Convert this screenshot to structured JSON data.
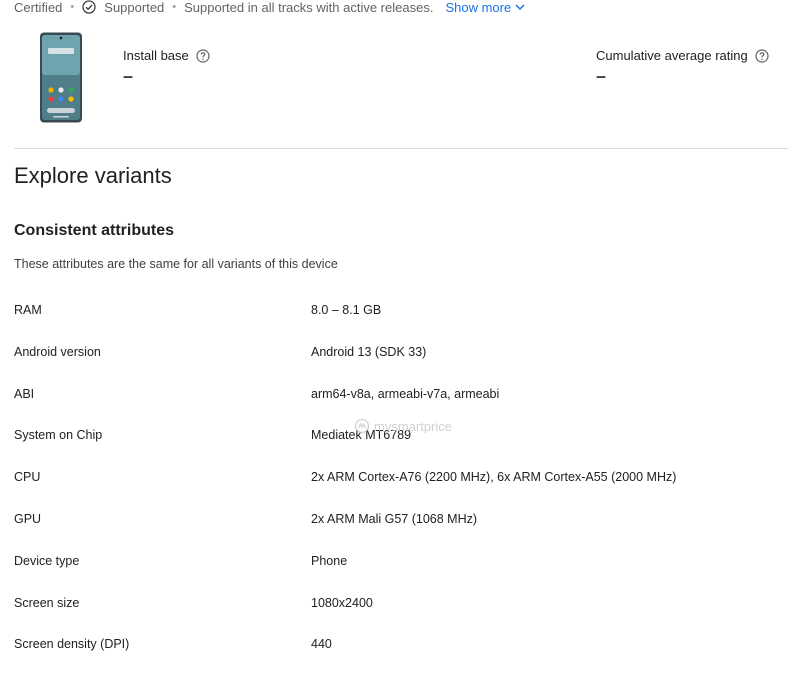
{
  "topbar": {
    "certified": "Certified",
    "supported": "Supported",
    "tracks": "Supported in all tracks with active releases.",
    "show_more": "Show more"
  },
  "stats": {
    "install_base_label": "Install base",
    "install_base_value": "–",
    "rating_label": "Cumulative average rating",
    "rating_value": "–"
  },
  "page": {
    "title": "Explore variants"
  },
  "consistent": {
    "title": "Consistent attributes",
    "description": "These attributes are the same for all variants of this device",
    "rows": [
      {
        "key": "RAM",
        "value": "8.0 – 8.1 GB"
      },
      {
        "key": "Android version",
        "value": "Android 13 (SDK 33)"
      },
      {
        "key": "ABI",
        "value": "arm64-v8a, armeabi-v7a, armeabi"
      },
      {
        "key": "System on Chip",
        "value": "Mediatek MT6789"
      },
      {
        "key": "CPU",
        "value": "2x ARM Cortex-A76 (2200 MHz), 6x ARM Cortex-A55 (2000 MHz)"
      },
      {
        "key": "GPU",
        "value": "2x ARM Mali G57 (1068 MHz)"
      },
      {
        "key": "Device type",
        "value": "Phone"
      },
      {
        "key": "Screen size",
        "value": "1080x2400"
      },
      {
        "key": "Screen density (DPI)",
        "value": "440"
      }
    ]
  },
  "watermark": "mysmartprice",
  "colors": {
    "link": "#1a73e8",
    "divider": "#dadce0",
    "muted_text": "#5f6368"
  },
  "icons": [
    "check-circle-icon",
    "chevron-down-icon",
    "help-icon",
    "phone-image"
  ]
}
